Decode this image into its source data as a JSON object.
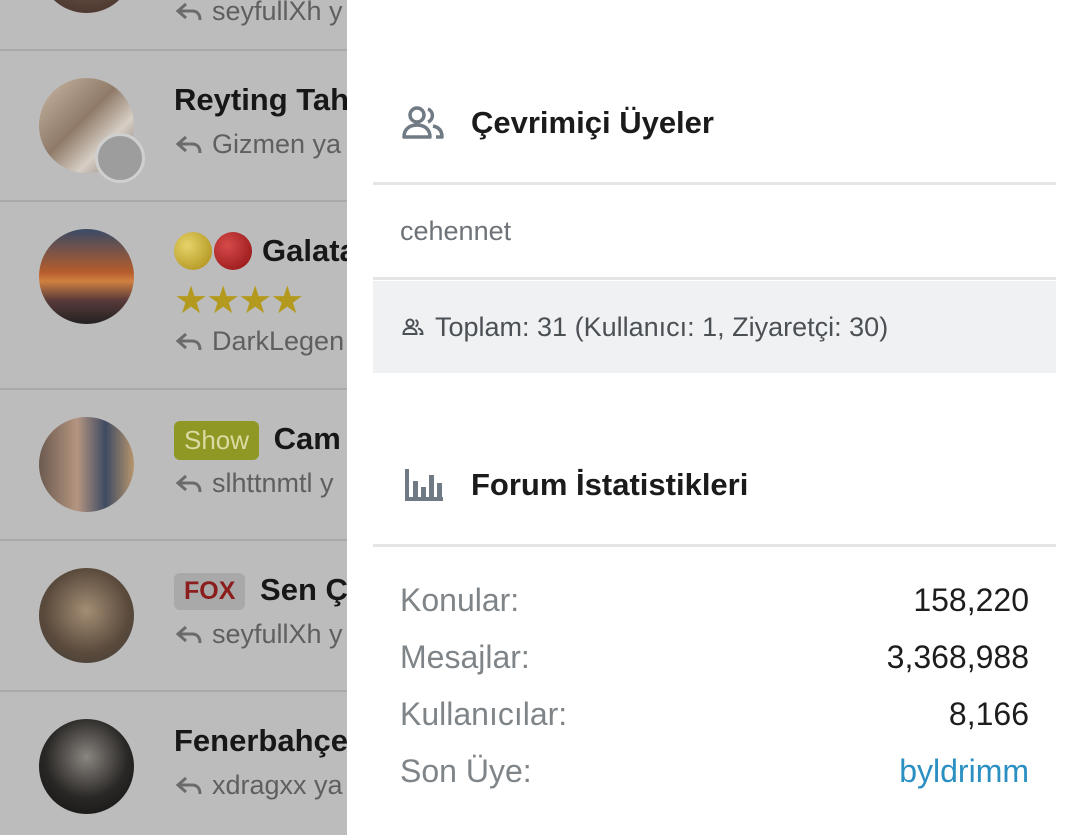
{
  "threads": [
    {
      "title": "",
      "subtitle": "seyfullXh y"
    },
    {
      "title": "Reyting Tah",
      "subtitle": "Gizmen ya"
    },
    {
      "title": "Galata",
      "subtitle": "DarkLegen",
      "stars": "★★★★"
    },
    {
      "title": "Cam",
      "badge": "Show",
      "subtitle": "slhttnmtl y"
    },
    {
      "title": "Sen Ç",
      "badge": "FOX",
      "subtitle": "seyfullXh y"
    },
    {
      "title": "Fenerbahçe",
      "subtitle": "xdragxx ya"
    }
  ],
  "online_members": {
    "heading": "Çevrimiçi Üyeler",
    "icon": "users-icon",
    "users": [
      "cehennet"
    ],
    "total_text": "Toplam: 31 (Kullanıcı: 1, Ziyaretçi: 30)"
  },
  "forum_stats": {
    "heading": "Forum İstatistikleri",
    "icon": "bar-chart-icon",
    "rows": [
      {
        "label": "Konular:",
        "value": "158,220"
      },
      {
        "label": "Mesajlar:",
        "value": "3,368,988"
      },
      {
        "label": "Kullanıcılar:",
        "value": "8,166"
      },
      {
        "label": "Son Üye:",
        "value": "byldrimm"
      }
    ]
  },
  "colors": {
    "overlay_bg": "#bcbcbc",
    "panel_bg": "#ffffff",
    "link": "#2b8fc2",
    "show_badge": "#8f9825",
    "fox_badge_text": "#8b1d1d"
  }
}
